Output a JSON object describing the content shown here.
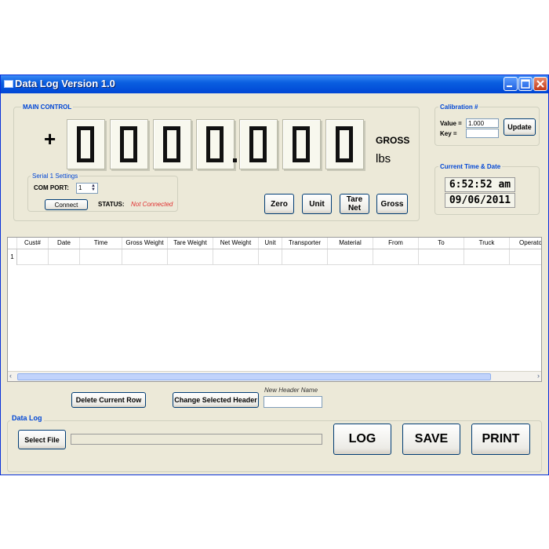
{
  "window": {
    "title": "Data Log Version 1.0"
  },
  "main_control": {
    "label": "MAIN CONTROL",
    "sign": "+",
    "display_digits": [
      "0",
      "0",
      "0",
      "0",
      "0",
      "0",
      "0"
    ],
    "decimal_point": ".",
    "mode": "GROSS",
    "unit": "lbs",
    "buttons": {
      "zero": "Zero",
      "unit": "Unit",
      "tare_net_line1": "Tare",
      "tare_net_line2": "Net",
      "gross": "Gross"
    }
  },
  "serial": {
    "label": "Serial 1 Settings",
    "com_port_label": "COM PORT:",
    "com_port_value": "1",
    "connect_label": "Connect",
    "status_label": "STATUS:",
    "status_value": "Not Connected",
    "status_color": "#e03030"
  },
  "calibration": {
    "label": "Calibration #",
    "value_label": "Value =",
    "value": "1.000",
    "key_label": "Key =",
    "key": "",
    "update_label": "Update"
  },
  "clock": {
    "label": "Current Time & Date",
    "time": "6:52:52 am",
    "date": "09/06/2011"
  },
  "grid": {
    "columns": [
      "Cust#",
      "Date",
      "Time",
      "Gross Weight",
      "Tare Weight",
      "Net Weight",
      "Unit",
      "Transporter",
      "Material",
      "From",
      "To",
      "Truck",
      "Operator"
    ],
    "row_numbers": [
      "1"
    ]
  },
  "actions": {
    "delete_row": "Delete Current Row",
    "change_header": "Change Selected Header",
    "new_header_label": "New Header Name",
    "new_header_value": ""
  },
  "data_log": {
    "label": "Data Log",
    "select_file": "Select File",
    "log": "LOG",
    "save": "SAVE",
    "print": "PRINT"
  }
}
